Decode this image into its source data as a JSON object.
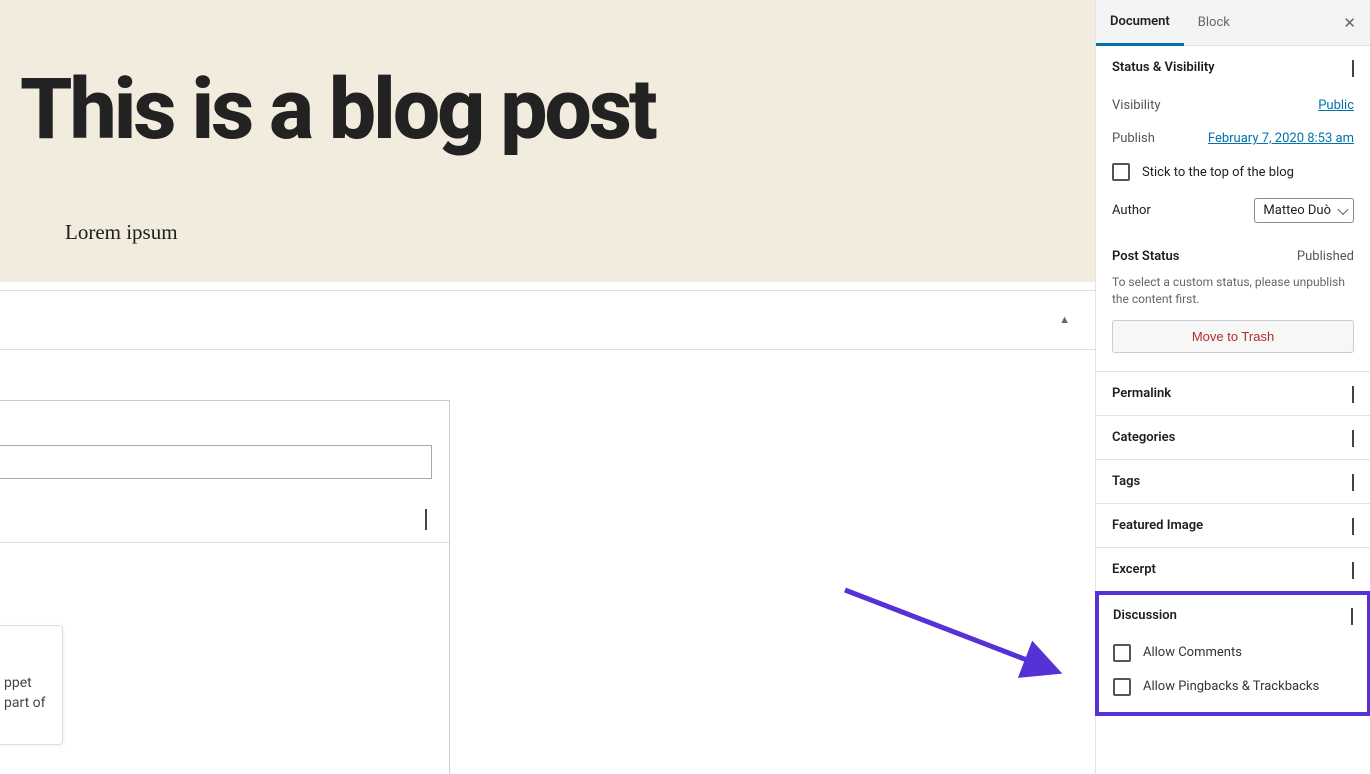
{
  "hero": {
    "title": "This is a blog post",
    "body": "Lorem ipsum"
  },
  "strip": {
    "collapse_glyph": "▲"
  },
  "snippet": {
    "line1": "ppet",
    "line2": "part of"
  },
  "tabs": {
    "document": "Document",
    "block": "Block",
    "close_glyph": "✕"
  },
  "status_panel": {
    "title": "Status & Visibility",
    "visibility_label": "Visibility",
    "visibility_value": "Public",
    "publish_label": "Publish",
    "publish_value": "February 7, 2020 8:53 am",
    "stick_label": "Stick to the top of the blog",
    "author_label": "Author",
    "author_value": "Matteo Duò",
    "post_status_label": "Post Status",
    "post_status_value": "Published",
    "help": "To select a custom status, please unpublish the content first.",
    "trash_label": "Move to Trash"
  },
  "panels": {
    "permalink": "Permalink",
    "categories": "Categories",
    "tags": "Tags",
    "featured_image": "Featured Image",
    "excerpt": "Excerpt"
  },
  "discussion": {
    "title": "Discussion",
    "allow_comments": "Allow Comments",
    "allow_pingbacks": "Allow Pingbacks & Trackbacks"
  }
}
